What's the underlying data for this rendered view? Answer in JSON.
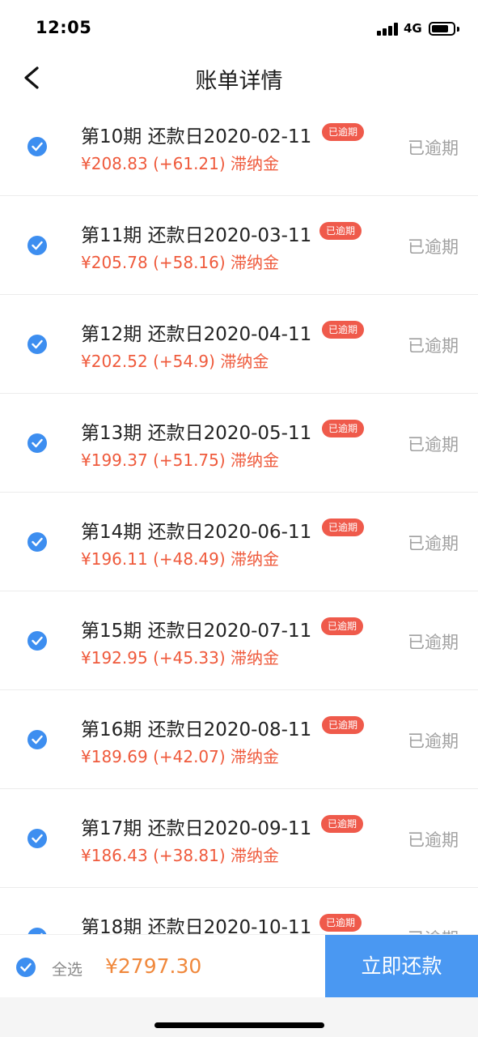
{
  "status_bar": {
    "time": "12:05",
    "network": "4G"
  },
  "nav": {
    "title": "账单详情"
  },
  "bills": [
    {
      "title": "第10期 还款日2020-02-11",
      "badge": "已逾期",
      "amount": "¥208.83  (+61.21) 滞纳金",
      "status": "已逾期",
      "checked": true
    },
    {
      "title": "第11期 还款日2020-03-11",
      "badge": "已逾期",
      "amount": "¥205.78  (+58.16) 滞纳金",
      "status": "已逾期",
      "checked": true
    },
    {
      "title": "第12期 还款日2020-04-11",
      "badge": "已逾期",
      "amount": "¥202.52  (+54.9) 滞纳金",
      "status": "已逾期",
      "checked": true
    },
    {
      "title": "第13期 还款日2020-05-11",
      "badge": "已逾期",
      "amount": "¥199.37  (+51.75) 滞纳金",
      "status": "已逾期",
      "checked": true
    },
    {
      "title": "第14期 还款日2020-06-11",
      "badge": "已逾期",
      "amount": "¥196.11  (+48.49) 滞纳金",
      "status": "已逾期",
      "checked": true
    },
    {
      "title": "第15期 还款日2020-07-11",
      "badge": "已逾期",
      "amount": "¥192.95  (+45.33) 滞纳金",
      "status": "已逾期",
      "checked": true
    },
    {
      "title": "第16期 还款日2020-08-11",
      "badge": "已逾期",
      "amount": "¥189.69  (+42.07) 滞纳金",
      "status": "已逾期",
      "checked": true
    },
    {
      "title": "第17期 还款日2020-09-11",
      "badge": "已逾期",
      "amount": "¥186.43  (+38.81) 滞纳金",
      "status": "已逾期",
      "checked": true
    },
    {
      "title": "第18期 还款日2020-10-11",
      "badge": "已逾期",
      "amount": "",
      "status": "已逾期",
      "checked": true
    }
  ],
  "footer": {
    "select_all_label": "全选",
    "total": "¥2797.30",
    "pay_label": "立即还款"
  },
  "colors": {
    "accent_blue": "#3d8ef0",
    "overdue_red": "#ef5a4b",
    "amount_red": "#ef5a3c",
    "total_orange": "#f0883c",
    "button_blue": "#4a98f2"
  }
}
